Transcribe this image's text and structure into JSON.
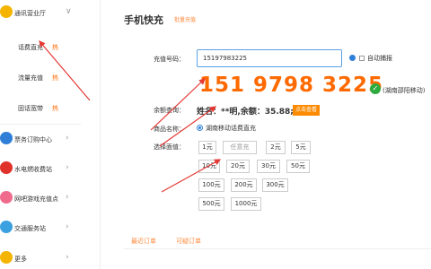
{
  "sidebar": {
    "items": [
      {
        "label": "通讯营业厅",
        "icon": "phone-hall-icon",
        "icon_color": "#f4b400",
        "chevron": "∨"
      },
      {
        "label": "票务订购中心",
        "icon": "ticket-icon",
        "icon_color": "#2f7fd8",
        "chevron": "›"
      },
      {
        "label": "水电燃收费站",
        "icon": "utility-icon",
        "icon_color": "#e0322b",
        "chevron": "›"
      },
      {
        "label": "网吧游戏充值点",
        "icon": "game-icon",
        "icon_color": "#f06a8c",
        "chevron": "›"
      },
      {
        "label": "交通服务站",
        "icon": "traffic-icon",
        "icon_color": "#3aa0e0",
        "chevron": "›"
      },
      {
        "label": "更多",
        "icon": "more-icon",
        "icon_color": "#f4b400",
        "chevron": "›"
      }
    ],
    "subitems": [
      {
        "label": "话费直充",
        "hot": "热"
      },
      {
        "label": "流量充值",
        "hot": "热"
      },
      {
        "label": "固话宽带",
        "hot": "热"
      }
    ]
  },
  "main": {
    "title": "手机快充",
    "title_link": "批量充值",
    "phone_label": "充值号码：",
    "phone_value": "15197983225",
    "auto_label": "自动捕报",
    "big_number": "151 9798 3225",
    "carrier": "(湖南邵阳移动)",
    "balance_label": "余额查询：",
    "balance_text": "姓名：**明,余额：35.88;",
    "balance_button": "点击查看",
    "product_label": "商品名称：",
    "product_name": "湖南移动话费直充",
    "amount_label": "选择面值：",
    "amounts": [
      "1元",
      "任意充",
      "2元",
      "5元",
      "10元",
      "20元",
      "30元",
      "50元",
      "100元",
      "200元",
      "300元",
      "500元",
      "1000元"
    ],
    "tabs": [
      "最近订单",
      "可疑订单"
    ]
  },
  "colors": {
    "accent": "#ff6a00",
    "link": "#ff8a3d",
    "input_border": "#5aa0e6",
    "success": "#2eaa3e",
    "annotation": "#e53935"
  }
}
